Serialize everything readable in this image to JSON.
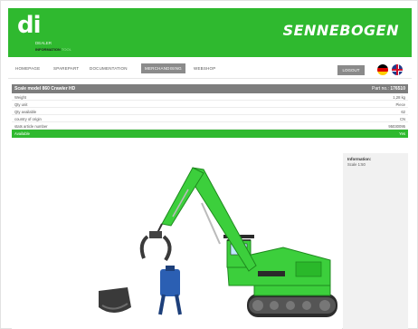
{
  "header": {
    "logo_text": "di",
    "logo_line1": "DEALER",
    "logo_line2": "INFORMATION",
    "logo_line2_suffix": "TOOL",
    "brand": "SENNEBOGEN"
  },
  "nav": {
    "items": [
      "HOMEPAGE",
      "SPAREPART",
      "DOCUMENTATION",
      "MERCHANDISING",
      "WEBSHOP"
    ],
    "active": "MERCHANDISING",
    "logout_label": "LOGOUT"
  },
  "product": {
    "title": "Scale model 860 Crawler HD",
    "part_label": "Part no.:",
    "part_number": "176510",
    "specs": [
      {
        "key": "Weight",
        "value": "1,28 kg"
      },
      {
        "key": "Qty unit",
        "value": "Piece"
      },
      {
        "key": "Qty available",
        "value": "62"
      },
      {
        "key": "country of origin",
        "value": "CN"
      },
      {
        "key": "stats article number",
        "value": "95030095"
      }
    ],
    "availability_label": "Available",
    "availability_value": "Yes"
  },
  "info": {
    "heading": "Information:",
    "scale": "Scale 1:50"
  },
  "colors": {
    "brand_green": "#2fb92f",
    "machine_green": "#3ccf3c",
    "header_gray": "#7d7d7d",
    "attachment_blue": "#2b5fb3"
  }
}
